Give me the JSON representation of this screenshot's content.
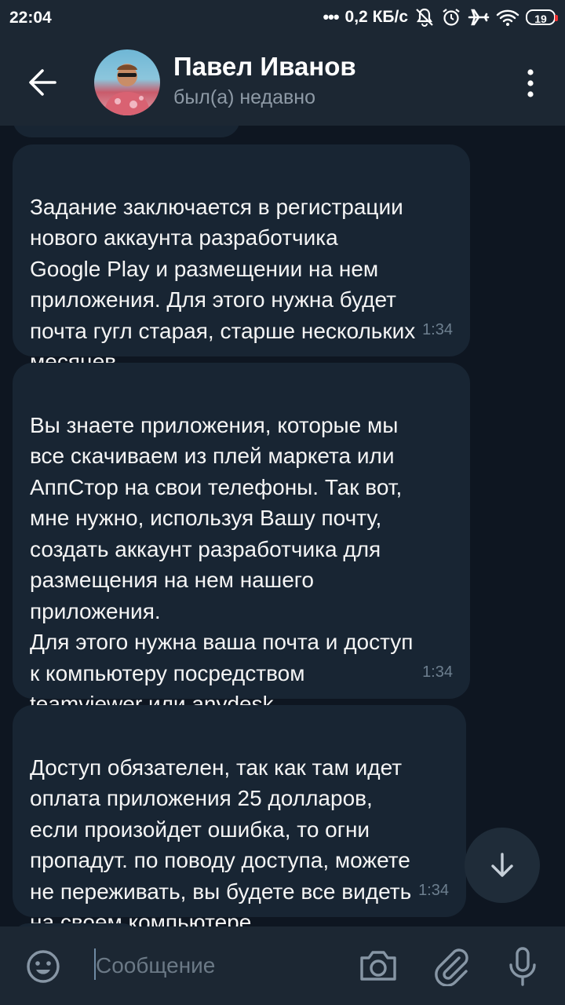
{
  "status_bar": {
    "time": "22:04",
    "network_speed": "0,2 КБ/с",
    "battery": "19",
    "icons": [
      "mute-icon",
      "alarm-icon",
      "airplane-icon",
      "wifi-icon",
      "battery-icon"
    ]
  },
  "header": {
    "contact_name": "Павел Иванов",
    "contact_status": "был(а) недавно"
  },
  "messages": [
    {
      "text": "Задание заключается в регистрации\nнового аккаунта разработчика\nGoogle Play и размещении на нем\nприложения. Для этого нужна будет\nпочта гугл старая, старше нескольких\nмесяцев",
      "time": "1:34"
    },
    {
      "text": "Вы знаете приложения, которые мы\nвсе скачиваем из плей маркета или\nАппСтор на свои телефоны. Так вот,\nмне нужно, используя Вашу почту,\nсоздать аккаунт разработчика для\nразмещения на нем нашего\nприложения.\nДля этого нужна ваша почта и доступ\nк компьютеру посредством\nteamviewer или anydesk.",
      "time": "1:34"
    },
    {
      "text": "Доступ обязателен, так как там идет\nоплата приложения 25 долларов,\nесли произойдет ошибка, то огни\nпропадут. по поводу доступа, можете\nне переживать, вы будете все видеть\nна своем компьютере",
      "time": "1:34"
    }
  ],
  "input": {
    "placeholder": "Сообщение",
    "value": ""
  },
  "colors": {
    "background": "#0e1621",
    "bar": "#1c2733",
    "bubble": "#182533",
    "muted_text": "#8e9aa6"
  }
}
